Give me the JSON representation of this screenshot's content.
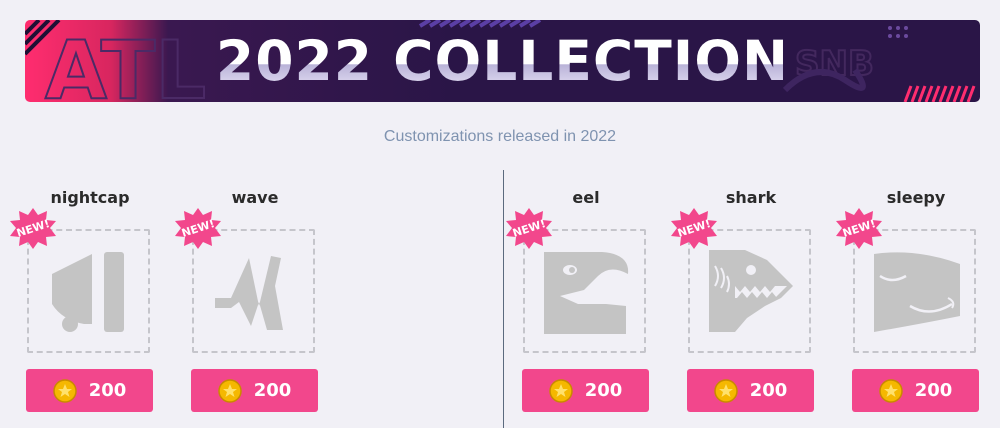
{
  "banner": {
    "title": "2022 COLLECTION"
  },
  "subtitle": "Customizations released in 2022",
  "badge_text": "NEW!",
  "colors": {
    "accent": "#f2478c",
    "banner_bg": "#2a1547",
    "banner_pink": "#ff2d6f",
    "icon_gray": "#c4c4c4"
  },
  "items": [
    {
      "name": "nightcap",
      "icon": "nightcap-icon",
      "price": "200"
    },
    {
      "name": "wave",
      "icon": "wave-icon",
      "price": "200"
    },
    {
      "name": "eel",
      "icon": "eel-icon",
      "price": "200"
    },
    {
      "name": "shark",
      "icon": "shark-icon",
      "price": "200"
    },
    {
      "name": "sleepy",
      "icon": "sleepy-icon",
      "price": "200"
    }
  ]
}
